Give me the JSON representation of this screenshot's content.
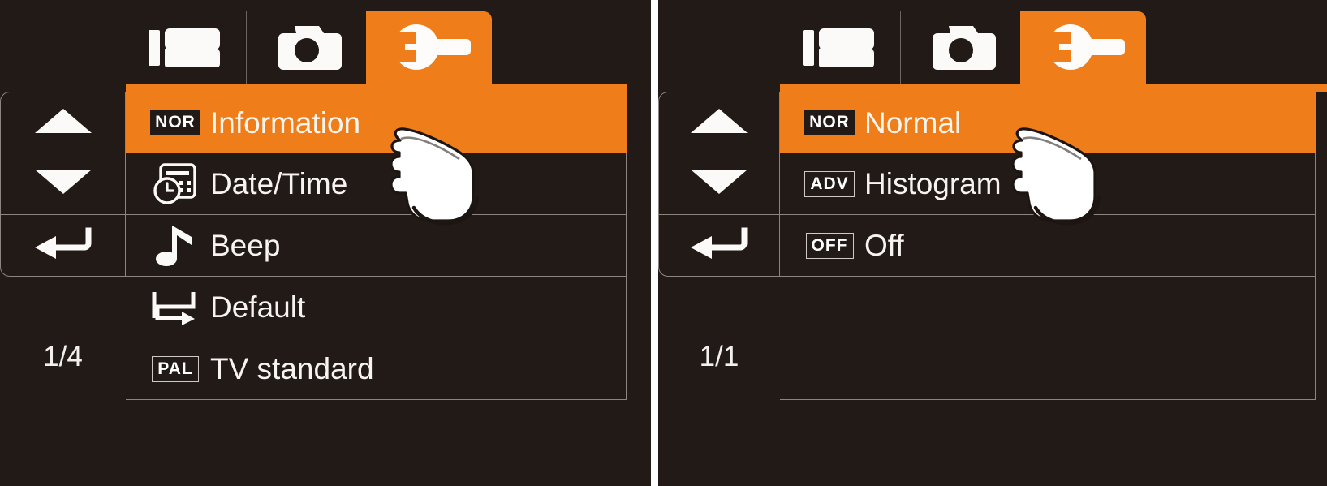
{
  "colors": {
    "accent": "#ee7d1a",
    "background": "#221a17",
    "outline": "#8c8580",
    "text": "#f6f3f1",
    "gutter": "#ffffff"
  },
  "panels": [
    {
      "name": "setup-menu-panel",
      "tabs": [
        {
          "icon": "video-camcorder-icon",
          "active": false
        },
        {
          "icon": "photo-camera-icon",
          "active": false
        },
        {
          "icon": "wrench-settings-icon",
          "active": true
        }
      ],
      "side_controls": [
        {
          "icon": "arrow-up-icon",
          "name": "scroll-up-button"
        },
        {
          "icon": "arrow-down-icon",
          "name": "scroll-down-button"
        },
        {
          "icon": "enter-return-icon",
          "name": "enter-button"
        }
      ],
      "page_indicator": "1/4",
      "rows": [
        {
          "badge": "NOR",
          "badge_style": "solid",
          "icon": "nor-badge-icon",
          "label": "Information",
          "selected": true
        },
        {
          "badge": "",
          "badge_style": "none",
          "icon": "calendar-clock-icon",
          "label": "Date/Time",
          "selected": false
        },
        {
          "badge": "",
          "badge_style": "none",
          "icon": "music-note-icon",
          "label": "Beep",
          "selected": false
        },
        {
          "badge": "",
          "badge_style": "none",
          "icon": "loop-arrow-icon",
          "label": "Default",
          "selected": false
        },
        {
          "badge": "PAL",
          "badge_style": "outline",
          "icon": "pal-badge-icon",
          "label": "TV standard",
          "selected": false
        }
      ]
    },
    {
      "name": "information-submenu-panel",
      "tabs": [
        {
          "icon": "video-camcorder-icon",
          "active": false
        },
        {
          "icon": "photo-camera-icon",
          "active": false
        },
        {
          "icon": "wrench-settings-icon",
          "active": true
        }
      ],
      "side_controls": [
        {
          "icon": "arrow-up-icon",
          "name": "scroll-up-button"
        },
        {
          "icon": "arrow-down-icon",
          "name": "scroll-down-button"
        },
        {
          "icon": "enter-return-icon",
          "name": "enter-button"
        }
      ],
      "page_indicator": "1/1",
      "rows": [
        {
          "badge": "NOR",
          "badge_style": "solid",
          "icon": "nor-badge-icon",
          "label": "Normal",
          "selected": true
        },
        {
          "badge": "ADV",
          "badge_style": "outline",
          "icon": "adv-badge-icon",
          "label": "Histogram",
          "selected": false
        },
        {
          "badge": "OFF",
          "badge_style": "outline",
          "icon": "off-badge-icon",
          "label": "Off",
          "selected": false
        },
        {
          "badge": "",
          "badge_style": "none",
          "icon": "",
          "label": "",
          "selected": false
        },
        {
          "badge": "",
          "badge_style": "none",
          "icon": "",
          "label": "",
          "selected": false
        }
      ]
    }
  ],
  "cursor": {
    "icon": "pointing-hand-cursor",
    "label": "pointing hand"
  }
}
